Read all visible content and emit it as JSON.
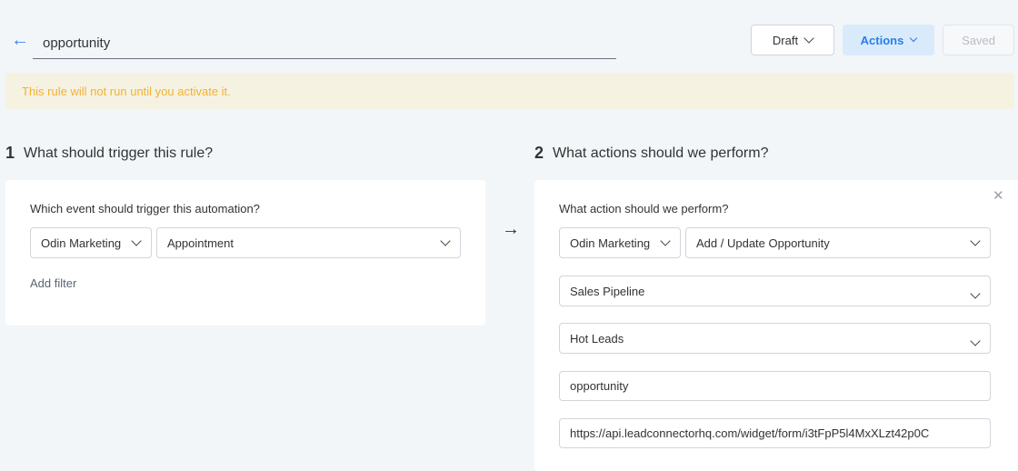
{
  "header": {
    "title_value": "opportunity",
    "draft_label": "Draft",
    "actions_label": "Actions",
    "saved_label": "Saved"
  },
  "banner": {
    "text": "This rule will not run until you activate it."
  },
  "trigger": {
    "step_number": "1",
    "heading": "What should trigger this rule?",
    "label": "Which event should trigger this automation?",
    "app": "Odin Marketing",
    "event": "Appointment",
    "add_filter": "Add filter"
  },
  "action": {
    "step_number": "2",
    "heading": "What actions should we perform?",
    "label": "What action should we perform?",
    "app": "Odin Marketing",
    "action": "Add / Update Opportunity",
    "pipeline": "Sales Pipeline",
    "stage": "Hot Leads",
    "name_value": "opportunity",
    "url_value": "https://api.leadconnectorhq.com/widget/form/i3tFpP5l4MxXLzt42p0C"
  },
  "colors": {
    "accent": "#2b7de9",
    "warning_text": "#f2b134",
    "warning_bg": "#f6f2e2"
  }
}
